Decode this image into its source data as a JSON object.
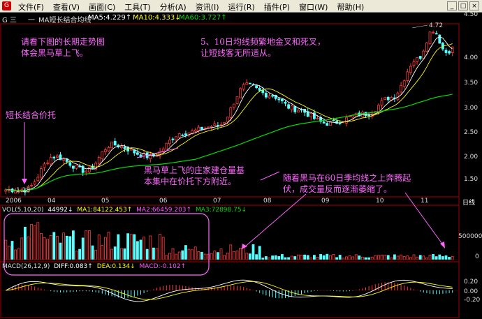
{
  "menu": {
    "app_icon": "G",
    "items": [
      "文件(F)",
      "查看(V)",
      "画面(C)",
      "工具(T)",
      "分析(A)",
      "资讯(I)",
      "运行(R)",
      "插件(P)",
      "窗口(W)",
      "帮助(H)"
    ],
    "win_buttons": [
      "_",
      "□",
      "×"
    ]
  },
  "title": {
    "prefix": "G 三",
    "dash": "一",
    "indicator": "MA短长结合均线",
    "ma5": "MA5:4.229↑",
    "ma10": "MA10:4.333↓",
    "ma60": "MA60:3.727↑"
  },
  "price_axis": [
    "4.50",
    "4.00",
    "3.50",
    "3.00",
    "2.50",
    "2.00",
    "1.50"
  ],
  "vol_axis": [
    "500000",
    "0"
  ],
  "macd_axis": [
    "0.20",
    "0.00",
    "-0.20"
  ],
  "dates": [
    "2006",
    "04",
    "05",
    "06",
    "07",
    "08",
    "09",
    "10",
    "11",
    "日线"
  ],
  "high_label": "4.72",
  "low_label": "1.28",
  "vol_header": {
    "name": "VOL(5,10,20)",
    "vol": "44992↓",
    "ma1": "MA1:84122.453↑",
    "ma2": "MA2:66459.203↑",
    "ma3": "MA3:72898.75↓"
  },
  "macd_header": {
    "name": "MACD(26,12,9)",
    "diff": "DIFF:0.083↑",
    "dea": "DEA:0.134↓",
    "macd": "MACD:-0.102↑"
  },
  "annotations": {
    "a1": [
      "请看下图的长期走势图",
      "体会黑马草上飞。"
    ],
    "a2": [
      "5、10日均线频繁地金叉和死叉，",
      "让短线客无所适从。"
    ],
    "a3": [
      "短长结合价托"
    ],
    "a4": [
      "黑马草上飞的庄家建仓量基",
      "本集中在价托下方附近。"
    ],
    "a5": [
      "随着黑马在60日季均线之上奔腾起",
      "伏，成交量反而逐渐萎缩了。"
    ]
  },
  "colors": {
    "up": "#ff3a3a",
    "down": "#54ffff",
    "ma5": "#ffffff",
    "ma10": "#ffff00",
    "ma60": "#00dd00",
    "annotation": "#ff66ff"
  }
}
